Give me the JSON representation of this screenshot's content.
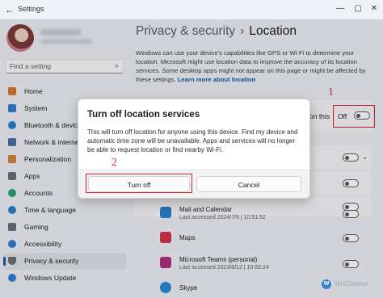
{
  "window": {
    "title": "Settings",
    "controls": [
      "minimize",
      "maximize",
      "close"
    ]
  },
  "sidebar": {
    "search_placeholder": "Find a setting",
    "items": [
      {
        "label": "Home",
        "icon": "home-icon",
        "color": "#d97a2b"
      },
      {
        "label": "System",
        "icon": "monitor-icon",
        "color": "#2f7fd1"
      },
      {
        "label": "Bluetooth & devices",
        "icon": "bluetooth-icon",
        "color": "#2f7fd1"
      },
      {
        "label": "Network & internet",
        "icon": "wifi-icon",
        "color": "#4a6fa5"
      },
      {
        "label": "Personalization",
        "icon": "brush-icon",
        "color": "#d2843a"
      },
      {
        "label": "Apps",
        "icon": "apps-icon",
        "color": "#6b6f76"
      },
      {
        "label": "Accounts",
        "icon": "person-icon",
        "color": "#2aa36b"
      },
      {
        "label": "Time & language",
        "icon": "globe-clock-icon",
        "color": "#2f7fd1"
      },
      {
        "label": "Gaming",
        "icon": "gamepad-icon",
        "color": "#6b6f76"
      },
      {
        "label": "Accessibility",
        "icon": "accessibility-icon",
        "color": "#2f7fd1"
      },
      {
        "label": "Privacy & security",
        "icon": "shield-icon",
        "color": "#6b6f76",
        "active": true
      },
      {
        "label": "Windows Update",
        "icon": "update-icon",
        "color": "#2f7fd1"
      }
    ]
  },
  "header": {
    "breadcrumb_parent": "Privacy & security",
    "separator": "›",
    "title": "Location"
  },
  "description": {
    "text": "Windows can use your device's capabilities like GPS or Wi-Fi to determine your location. Microsoft might use location data to improve the accuracy of its location services. Some desktop apps might not appear on this page or might be affected by these settings.",
    "link": "Learn more about location"
  },
  "location_services": {
    "partial_label": "on this",
    "state_label": "Off",
    "annotation": "1"
  },
  "dialog": {
    "title": "Turn off location services",
    "body": "This will turn off location for anyone using this device. Find my device and automatic time zone will be unavailable. Apps and services will no longer be able to request location or find nearby Wi-Fi.",
    "primary_label": "Turn off",
    "secondary_label": "Cancel",
    "annotation": "2"
  },
  "apps": [
    {
      "name": "Mail and Calendar",
      "sub": "Last accessed 2024/7/9 | 10:51:52",
      "icon_color": "#2f7fd1"
    },
    {
      "name": "Maps",
      "sub": "",
      "icon_color": "#d6334a"
    },
    {
      "name": "Microsoft Teams (personal)",
      "sub": "Last accessed 2023/6/12 | 10:55:24",
      "icon_color": "#b0307f"
    },
    {
      "name": "Skype",
      "sub": "",
      "icon_color": "#2b8ad6"
    }
  ],
  "watermark": "WinCleaner"
}
